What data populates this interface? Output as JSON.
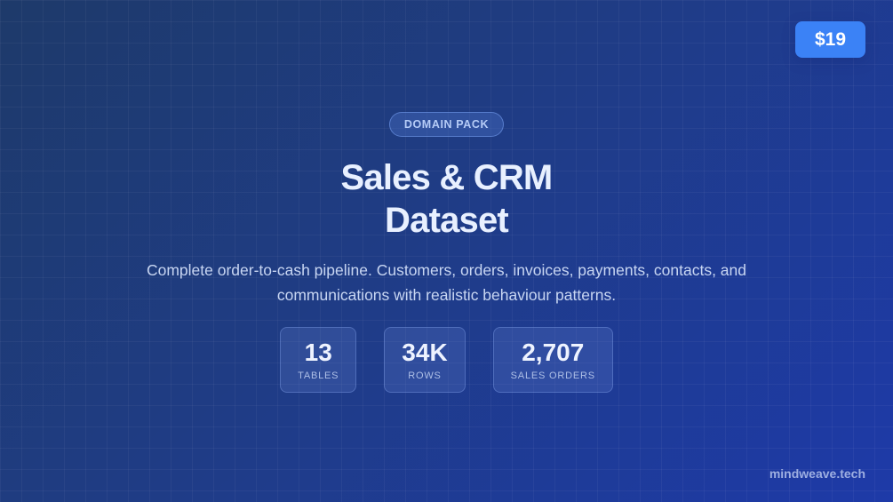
{
  "price": "$19",
  "badge": "DOMAIN PACK",
  "title": {
    "line1": "Sales & CRM",
    "line2": "Dataset"
  },
  "description": "Complete order-to-cash pipeline. Customers, orders, invoices, payments, contacts, and communications with realistic behaviour patterns.",
  "stats": [
    {
      "value": "13",
      "label": "TABLES"
    },
    {
      "value": "34K",
      "label": "ROWS"
    },
    {
      "value": "2,707",
      "label": "SALES ORDERS"
    }
  ],
  "footer": "mindweave.tech",
  "colors": {
    "accent": "#3b82f6",
    "background_start": "#1e3a6a",
    "background_end": "#1e3aa8"
  }
}
